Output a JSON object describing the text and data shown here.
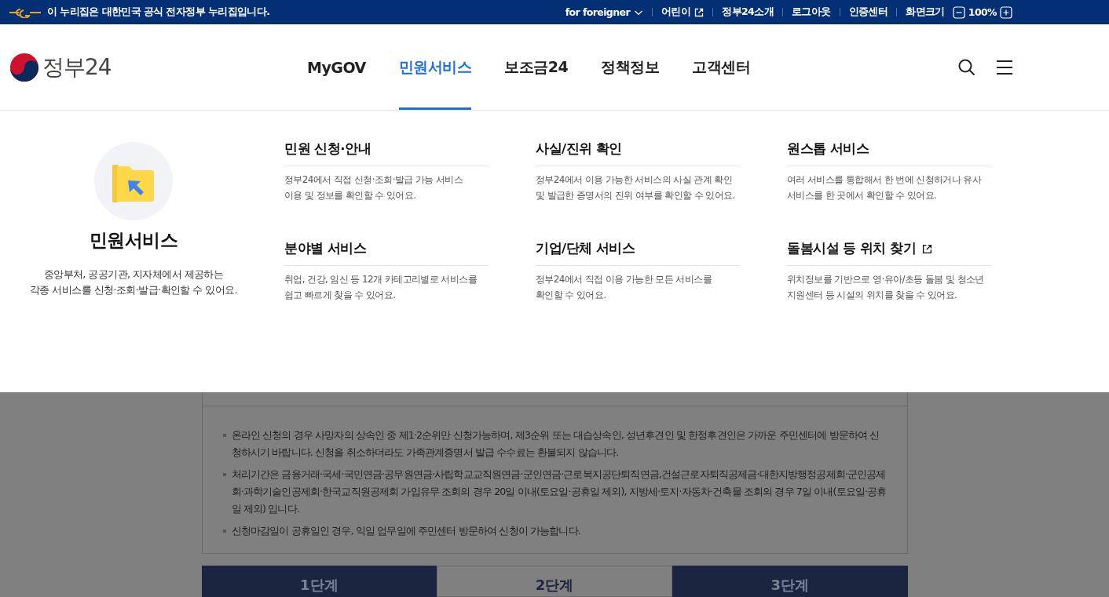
{
  "top_bar": {
    "notice": "이 누리집은 대한민국 공식 전자정부 누리집입니다.",
    "links": [
      {
        "label": "for foreigner",
        "kind": "dropdown"
      },
      {
        "label": "어린이",
        "kind": "external"
      },
      {
        "label": "정부24소개",
        "kind": "plain"
      },
      {
        "label": "로그아웃",
        "kind": "plain"
      },
      {
        "label": "인증센터",
        "kind": "plain"
      }
    ],
    "zoom": {
      "label": "화면크기",
      "value": "100%"
    }
  },
  "header": {
    "logo": "정부24",
    "nav": [
      {
        "label": "MyGOV",
        "selected": false
      },
      {
        "label": "민원서비스",
        "selected": true
      },
      {
        "label": "보조금24",
        "selected": false
      },
      {
        "label": "정책정보",
        "selected": false
      },
      {
        "label": "고객센터",
        "selected": false
      }
    ]
  },
  "mega_menu": {
    "title": "민원서비스",
    "description": "중앙부처, 공공기관, 지자체에서 제공하는\n각종 서비스를 신청·조회·발급·확인할 수 있어요.",
    "items": [
      {
        "title": "민원 신청·안내",
        "description": "정부24에서 직접 신청·조회·발급 가능 서비스\n이용 및 정보를 확인할 수 있어요.",
        "external": false
      },
      {
        "title": "사실/진위 확인",
        "description": "정부24에서 이용 가능한 서비스의 사실 관계 확인\n및 발급한 증명서의 진위 여부를 확인할 수 있어요.",
        "external": false
      },
      {
        "title": "원스톱 서비스",
        "description": "여러 서비스를 통합해서 한 번에 신청하거나 유사\n서비스를 한 곳에서 확인할 수 있어요.",
        "external": false
      },
      {
        "title": "분야별 서비스",
        "description": "취업, 건강, 임신 등 12개 카테고리별로 서비스를\n쉽고 빠르게 찾을 수 있어요.",
        "external": false
      },
      {
        "title": "기업/단체 서비스",
        "description": "정부24에서 직접 이용 가능한 모든 서비스를\n확인할 수 있어요.",
        "external": false
      },
      {
        "title": "돌봄시설 등 위치 찾기",
        "description": "위치정보를 기반으로 영·유아/초등 돌봄 및 청소년\n지원센터 등 시설의 위치를 찾을 수 있어요.",
        "external": true
      }
    ]
  },
  "notices": [
    "온라인 신청의 경우 사망자의 상속인 중 제1·2순위만 신청가능하며, 제3순위 또는 대습상속인, 성년후견인 및 한정후견인은 가까운 주민센터에 방문하여 신청하시기 바랍니다. 신청을 취소하더라도 가족관계증명서 발급 수수료는 환불되지 않습니다.",
    "처리기간은 금융거래·국세·국민연금·공무원연금·사립학교교직원연금·군인연금·근로복지공단퇴직연금,건설근로자퇴직공제금·대한지방행정공제회·군인공제회·과학기술인공제회·한국교직원공제회 가입유무 조회의 경우 20일 이내(토요일·공휴일 제외), 지방세·토지·자동차·건축물 조회의 경우 7일 이내(토요일·공휴일 제외) 입니다.",
    "신청마감일이 공휴일인 경우, 익일 업무일에 주민센터 방문하여 신청이 가능합니다."
  ],
  "steps": [
    {
      "label": "1단계",
      "selected": false
    },
    {
      "label": "2단계",
      "selected": true
    },
    {
      "label": "3단계",
      "selected": false
    }
  ]
}
